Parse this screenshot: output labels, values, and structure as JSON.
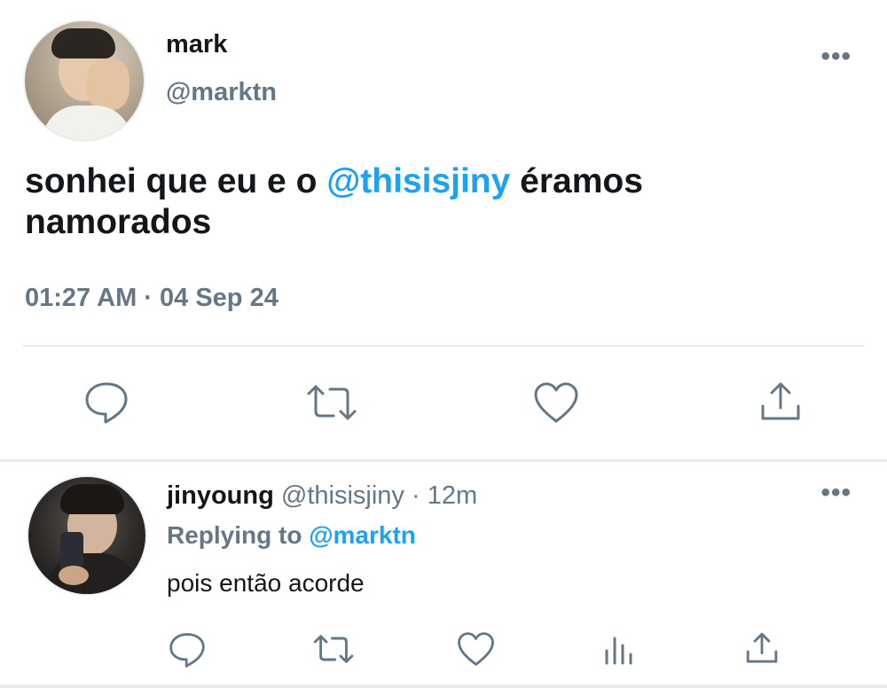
{
  "tweet": {
    "author_name": "mark",
    "author_handle": "@marktn",
    "text_before": "sonhei que eu e o ",
    "mention": "@thisisjiny",
    "text_after": " éramos namorados",
    "timestamp": "01:27 AM · 04 Sep 24",
    "more_label": "•••",
    "actions": [
      "reply",
      "retweet",
      "like",
      "share"
    ]
  },
  "reply": {
    "author_name": "jinyoung",
    "author_handle": "@thisisjiny",
    "separator": " · ",
    "time": "12m",
    "replying_prefix": "Replying to ",
    "replying_to": "@marktn",
    "text": "pois então acorde",
    "more_label": "•••",
    "actions": [
      "reply",
      "retweet",
      "like",
      "analytics",
      "share"
    ]
  },
  "colors": {
    "accent": "#1da1f2",
    "secondary_text": "#657786",
    "primary_text": "#14171a",
    "divider": "#e6ecf0"
  },
  "icons": {
    "reply": "speech-bubble-icon",
    "retweet": "retweet-icon",
    "like": "heart-icon",
    "share": "share-icon",
    "analytics": "bar-chart-icon",
    "more": "ellipsis-icon"
  }
}
